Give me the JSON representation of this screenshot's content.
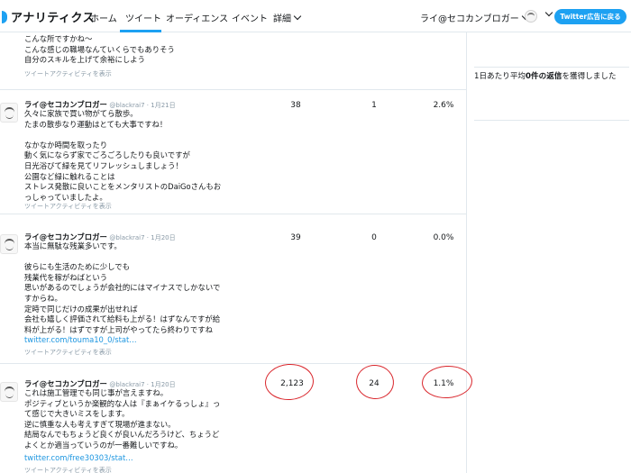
{
  "header": {
    "brand": "アナリティクス",
    "nav": [
      "ホーム",
      "ツイート",
      "オーディエンス",
      "イベント",
      "詳細"
    ],
    "account": "ライ@セコカンブロガー",
    "ads_button": "Twitter広告に戻る",
    "colors": {
      "accent": "#1da1f2"
    }
  },
  "side": {
    "prefix": "1日あたり平均",
    "bold": "0件の返信",
    "suffix": "を獲得しました"
  },
  "tweets": [
    {
      "name": "",
      "handle": "",
      "text": "こんな所ですかね〜\nこんな感じの職場なんていくらでもありそう\n自分のスキルを上げて余裕にしよう",
      "link": "",
      "activity": "ツイートアクティビティを表示",
      "impressions": "",
      "engagements": "",
      "rate": ""
    },
    {
      "name": "ライ@セコカンブロガー",
      "handle": "@blackrai7 · 1月21日",
      "text": "久々に家族で買い物がてら散歩。\nたまの散歩なり運動はとても大事ですね！\n\nなかなか時間を取ったり\n動く気にならず家でごろごろしたりも良いですが\n日光浴びて緑を見てリフレッシュしましょう！\n公園など緑に触れることは\nストレス発散に良いことをメンタリストのDaiGoさんもお\nっしゃっていましたよ。",
      "link": "",
      "activity": "ツイートアクティビティを表示",
      "impressions": "38",
      "engagements": "1",
      "rate": "2.6%"
    },
    {
      "name": "ライ@セコカンブロガー",
      "handle": "@blackrai7 · 1月20日",
      "text": "本当に無駄な残業多いです。\n\n彼らにも生活のために少しでも\n残業代を稼がねばという\n思いがあるのでしょうが会社的にはマイナスでしかないで\nすからね。\n定時で同じだけの成果が出せれば\n会社も嬉しく評価されて給料も上がる！はずなんですが給\n料が上がる！はずですが上司がやってたら終わりですね",
      "link": "twitter.com/touma10_0/stat…",
      "activity": "ツイートアクティビティを表示",
      "impressions": "39",
      "engagements": "0",
      "rate": "0.0%"
    },
    {
      "name": "ライ@セコカンブロガー",
      "handle": "@blackrai7 · 1月20日",
      "text": "これは施工管理でも同じ事が言えますね。\nポジティブというか楽観的な人は『まぁイケるっしょ』っ\nて感じで大きいミスをします。\n逆に慎重な人も考えすぎて現場が進まない。\n結局なんでもちょうど良くが良いんだろうけど、ちょうど\nよくとか適当っていうのが一番難しいですね。",
      "link": "twitter.com/free30303/stat…",
      "activity": "ツイートアクティビティを表示",
      "impressions": "2,123",
      "engagements": "24",
      "rate": "1.1%"
    }
  ]
}
